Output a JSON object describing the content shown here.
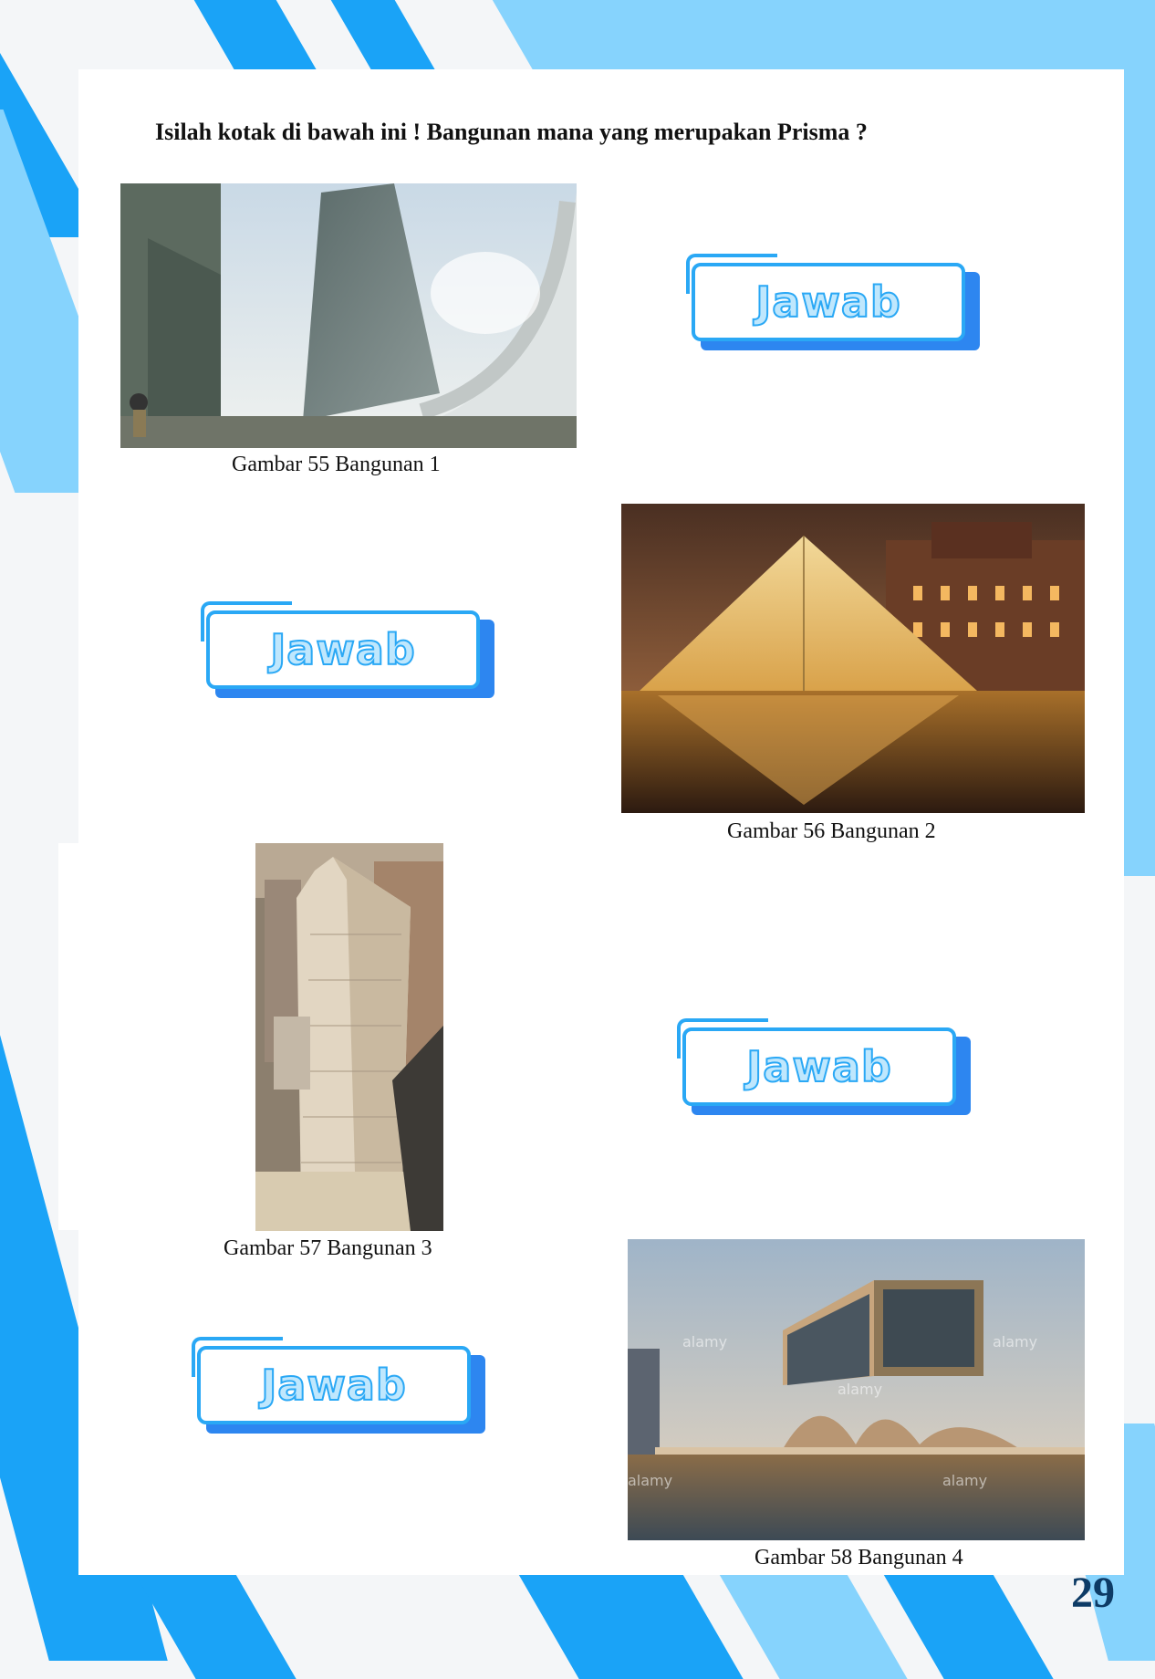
{
  "question": "Isilah kotak di bawah ini ! Bangunan mana yang merupakan Prisma ?",
  "jawab_label": "Jawab",
  "figures": [
    {
      "caption": "Gambar 55 Bangunan 1"
    },
    {
      "caption": "Gambar 56 Bangunan 2"
    },
    {
      "caption": "Gambar 57 Bangunan 3"
    },
    {
      "caption": "Gambar 58 Bangunan 4",
      "watermark": "alamy"
    }
  ],
  "page_number": "29",
  "colors": {
    "stripe_dark": "#1aa3f7",
    "stripe_light": "#86d3fd",
    "button_border": "#2aa8f5",
    "button_shadow": "#2d86f0"
  }
}
